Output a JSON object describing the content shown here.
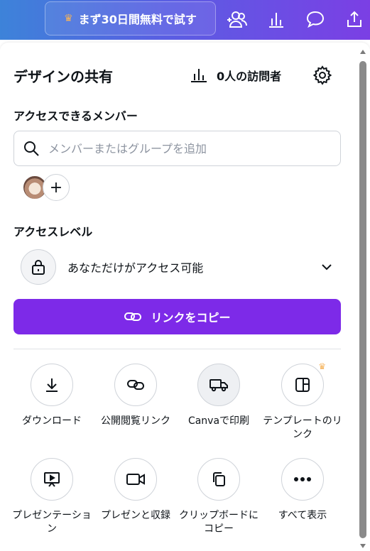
{
  "topbar": {
    "trial_label": "まず30日間無料で試す",
    "icons": [
      "people-add-icon",
      "bar-chart-icon",
      "comment-icon",
      "share-icon"
    ]
  },
  "share": {
    "title": "デザインの共有",
    "visitors": "0人の訪問者",
    "members_label": "アクセスできるメンバー",
    "search_placeholder": "メンバーまたはグループを追加",
    "access_level_label": "アクセスレベル",
    "access_level_value": "あなただけがアクセス可能",
    "copy_link_label": "リンクをコピー"
  },
  "actions": [
    {
      "label": "ダウンロード",
      "icon": "download-icon"
    },
    {
      "label": "公開閲覧リンク",
      "icon": "link-icon"
    },
    {
      "label": "Canvaで印刷",
      "icon": "truck-icon"
    },
    {
      "label": "テンプレートのリンク",
      "icon": "template-icon",
      "premium": true
    },
    {
      "label": "プレゼンテーション",
      "icon": "presentation-icon"
    },
    {
      "label": "プレゼンと収録",
      "icon": "video-icon"
    },
    {
      "label": "クリップボードにコピー",
      "icon": "copy-icon"
    },
    {
      "label": "すべて表示",
      "icon": "more-icon"
    }
  ],
  "colors": {
    "accent": "#7d2ae8",
    "crown": "#f5b35b",
    "topbar_start": "#3d83d9",
    "topbar_end": "#7b3fe4"
  }
}
